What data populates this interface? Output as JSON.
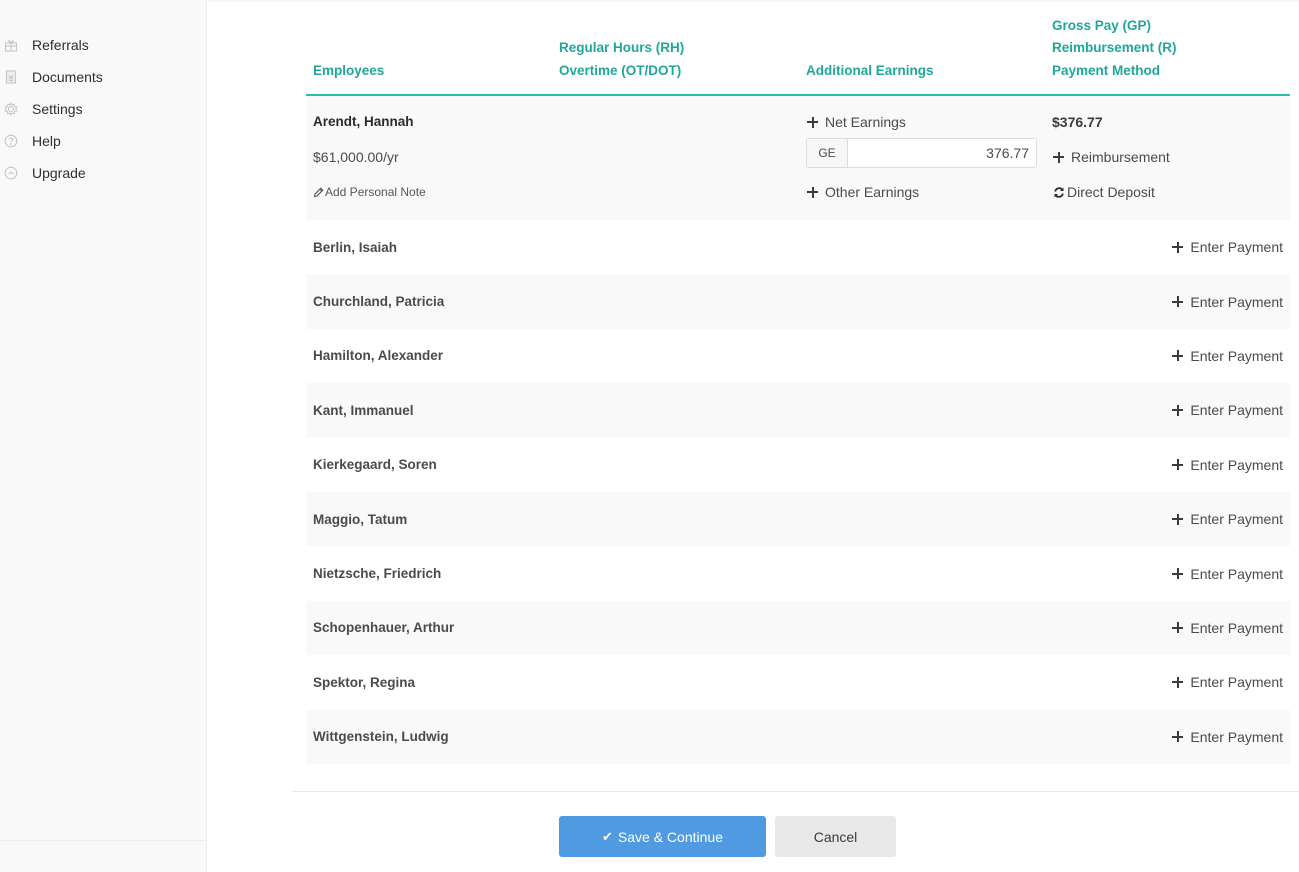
{
  "sidebar": {
    "items": [
      {
        "label": "Referrals",
        "icon": "gift-icon"
      },
      {
        "label": "Documents",
        "icon": "document-icon"
      },
      {
        "label": "Settings",
        "icon": "gear-icon"
      },
      {
        "label": "Help",
        "icon": "help-circle-icon"
      },
      {
        "label": "Upgrade",
        "icon": "upgrade-circle-icon"
      }
    ]
  },
  "table": {
    "headers": {
      "employees": [
        "Employees"
      ],
      "hours": [
        "Regular Hours (RH)",
        "Overtime (OT/DOT)"
      ],
      "additional": [
        "Additional Earnings"
      ],
      "pay": [
        "Gross Pay (GP)",
        "Reimbursement (R)",
        "Payment Method"
      ]
    },
    "expanded_row": {
      "name": "Arendt, Hannah",
      "salary": "$61,000.00/yr",
      "add_note_label": "Add Personal Note",
      "net_earnings_label": "Net Earnings",
      "ge_addon": "GE",
      "ge_value": "376.77",
      "other_earnings_label": "Other Earnings",
      "gross_pay": "$376.77",
      "reimbursement_label": "Reimbursement",
      "payment_method": "Direct Deposit"
    },
    "enter_payment_label": "Enter Payment",
    "rows": [
      {
        "name": "Berlin, Isaiah"
      },
      {
        "name": "Churchland, Patricia"
      },
      {
        "name": "Hamilton, Alexander"
      },
      {
        "name": "Kant, Immanuel"
      },
      {
        "name": "Kierkegaard, Soren"
      },
      {
        "name": "Maggio, Tatum"
      },
      {
        "name": "Nietzsche, Friedrich"
      },
      {
        "name": "Schopenhauer, Arthur"
      },
      {
        "name": "Spektor, Regina"
      },
      {
        "name": "Wittgenstein, Ludwig"
      }
    ]
  },
  "footer": {
    "save_label": "Save & Continue",
    "save_icon": "checkmark-icon",
    "cancel_label": "Cancel"
  },
  "colors": {
    "accent_teal": "#1fa899",
    "header_border": "#26bfac",
    "primary_button": "#4f9ae0",
    "secondary_button": "#e8e8e8",
    "row_alt": "#f9f9f9"
  }
}
